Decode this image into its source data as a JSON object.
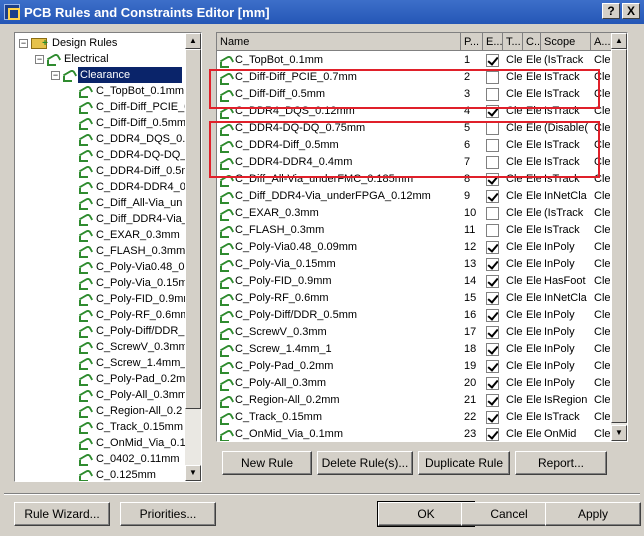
{
  "window": {
    "title": "PCB Rules and Constraints Editor [mm]",
    "help": "?",
    "close": "X"
  },
  "tree": {
    "root": "Design Rules",
    "category": "Electrical",
    "selected": "Clearance",
    "rules": [
      "C_TopBot_0.1mm",
      "C_Diff-Diff_PCIE_0",
      "C_Diff-Diff_0.5mm",
      "C_DDR4_DQS_0.12",
      "C_DDR4-DQ-DQ_0.7",
      "C_DDR4-Diff_0.5m",
      "C_DDR4-DDR4_0.4",
      "C_Diff_All-Via_un",
      "C_Diff_DDR4-Via_",
      "C_EXAR_0.3mm",
      "C_FLASH_0.3mm",
      "C_Poly-Via0.48_0.",
      "C_Poly-Via_0.15m",
      "C_Poly-FID_0.9mm",
      "C_Poly-RF_0.6mm",
      "C_Poly-Diff/DDR_",
      "C_ScrewV_0.3mm",
      "C_Screw_1.4mm_1",
      "C_Poly-Pad_0.2mm",
      "C_Poly-All_0.3mm",
      "C_Region-All_0.2",
      "C_Track_0.15mm",
      "C_OnMid_Via_0.1",
      "C_0402_0.11mm",
      "C_0.125mm"
    ]
  },
  "grid": {
    "headers": [
      "Name",
      "P...",
      "E...",
      "T...",
      "C...",
      "Scope",
      "A..."
    ],
    "rows": [
      {
        "name": "C_TopBot_0.1mm",
        "p": "1",
        "e": true,
        "t": "Cle",
        "c": "Ele",
        "s": "(IsTrack",
        "a": "Cle"
      },
      {
        "name": "C_Diff-Diff_PCIE_0.7mm",
        "p": "2",
        "e": false,
        "t": "Cle",
        "c": "Ele",
        "s": "IsTrack",
        "a": "Cle"
      },
      {
        "name": "C_Diff-Diff_0.5mm",
        "p": "3",
        "e": false,
        "t": "Cle",
        "c": "Ele",
        "s": "IsTrack",
        "a": "Cle"
      },
      {
        "name": "C_DDR4_DQS_0.12mm",
        "p": "4",
        "e": true,
        "t": "Cle",
        "c": "Ele",
        "s": "IsTrack",
        "a": "Cle"
      },
      {
        "name": "C_DDR4-DQ-DQ_0.75mm",
        "p": "5",
        "e": false,
        "t": "Cle",
        "c": "Ele",
        "s": "(Disable(",
        "a": "Cle"
      },
      {
        "name": "C_DDR4-Diff_0.5mm",
        "p": "6",
        "e": false,
        "t": "Cle",
        "c": "Ele",
        "s": "IsTrack",
        "a": "Cle"
      },
      {
        "name": "C_DDR4-DDR4_0.4mm",
        "p": "7",
        "e": false,
        "t": "Cle",
        "c": "Ele",
        "s": "IsTrack",
        "a": "Cle"
      },
      {
        "name": "C_Diff_All-Via_underFMC_0.185mm",
        "p": "8",
        "e": true,
        "t": "Cle",
        "c": "Ele",
        "s": "IsTrack",
        "a": "Cle"
      },
      {
        "name": "C_Diff_DDR4-Via_underFPGA_0.12mm",
        "p": "9",
        "e": true,
        "t": "Cle",
        "c": "Ele",
        "s": "InNetCla",
        "a": "Cle"
      },
      {
        "name": "C_EXAR_0.3mm",
        "p": "10",
        "e": false,
        "t": "Cle",
        "c": "Ele",
        "s": "(IsTrack",
        "a": "Cle"
      },
      {
        "name": "C_FLASH_0.3mm",
        "p": "11",
        "e": false,
        "t": "Cle",
        "c": "Ele",
        "s": "IsTrack",
        "a": "Cle"
      },
      {
        "name": "C_Poly-Via0.48_0.09mm",
        "p": "12",
        "e": true,
        "t": "Cle",
        "c": "Ele",
        "s": "InPoly",
        "a": "Cle"
      },
      {
        "name": "C_Poly-Via_0.15mm",
        "p": "13",
        "e": true,
        "t": "Cle",
        "c": "Ele",
        "s": "InPoly",
        "a": "Cle"
      },
      {
        "name": "C_Poly-FID_0.9mm",
        "p": "14",
        "e": true,
        "t": "Cle",
        "c": "Ele",
        "s": "HasFoot",
        "a": "Cle"
      },
      {
        "name": "C_Poly-RF_0.6mm",
        "p": "15",
        "e": true,
        "t": "Cle",
        "c": "Ele",
        "s": "InNetCla",
        "a": "Cle"
      },
      {
        "name": "C_Poly-Diff/DDR_0.5mm",
        "p": "16",
        "e": true,
        "t": "Cle",
        "c": "Ele",
        "s": "InPoly",
        "a": "Cle"
      },
      {
        "name": "C_ScrewV_0.3mm",
        "p": "17",
        "e": true,
        "t": "Cle",
        "c": "Ele",
        "s": "InPoly",
        "a": "Cle"
      },
      {
        "name": "C_Screw_1.4mm_1",
        "p": "18",
        "e": true,
        "t": "Cle",
        "c": "Ele",
        "s": "InPoly",
        "a": "Cle"
      },
      {
        "name": "C_Poly-Pad_0.2mm",
        "p": "19",
        "e": true,
        "t": "Cle",
        "c": "Ele",
        "s": "InPoly",
        "a": "Cle"
      },
      {
        "name": "C_Poly-All_0.3mm",
        "p": "20",
        "e": true,
        "t": "Cle",
        "c": "Ele",
        "s": "InPoly",
        "a": "Cle"
      },
      {
        "name": "C_Region-All_0.2mm",
        "p": "21",
        "e": true,
        "t": "Cle",
        "c": "Ele",
        "s": "IsRegion",
        "a": "Cle"
      },
      {
        "name": "C_Track_0.15mm",
        "p": "22",
        "e": true,
        "t": "Cle",
        "c": "Ele",
        "s": "IsTrack",
        "a": "Cle"
      },
      {
        "name": "C_OnMid_Via_0.1mm",
        "p": "23",
        "e": true,
        "t": "Cle",
        "c": "Ele",
        "s": "OnMid",
        "a": "Cle"
      }
    ]
  },
  "grid_buttons": {
    "new": "New Rule",
    "delete": "Delete Rule(s)...",
    "duplicate": "Duplicate Rule",
    "report": "Report..."
  },
  "footer": {
    "wizard": "Rule Wizard...",
    "priorities": "Priorities...",
    "ok": "OK",
    "cancel": "Cancel",
    "apply": "Apply"
  },
  "accent": {
    "highlight": "#e0202a",
    "selection": "#0a246a",
    "titlebar": "#2456b6"
  }
}
